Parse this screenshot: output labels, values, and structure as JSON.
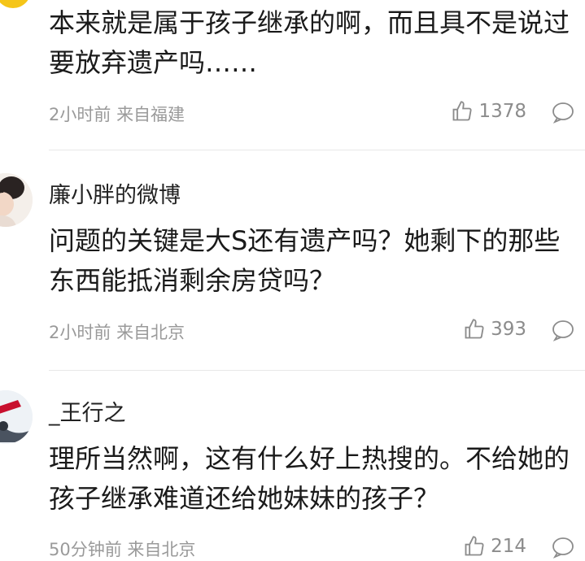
{
  "comments": [
    {
      "username": "",
      "text": "本来就是属于孩子继承的啊，而且具不是说过要放弃遗产吗……",
      "time": "2小时前",
      "location": "来自福建",
      "likes": "1378"
    },
    {
      "username": "廉小胖的微博",
      "text": "问题的关键是大S还有遗产吗？她剩下的那些东西能抵消剩余房贷吗？",
      "time": "2小时前",
      "location": "来自北京",
      "likes": "393"
    },
    {
      "username": "_王行之",
      "text": "理所当然啊，这有什么好上热搜的。不给她的孩子继承难道还给她妹妹的孩子？",
      "time": "50分钟前",
      "location": "来自北京",
      "likes": "214"
    }
  ],
  "icons": {
    "like": "thumbs-up-icon",
    "reply": "comment-bubble-icon",
    "badge": "vip-badge-icon"
  },
  "colors": {
    "meta": "#9a9a9a",
    "badge": "#f5c518",
    "divider": "#e8e8e8"
  }
}
